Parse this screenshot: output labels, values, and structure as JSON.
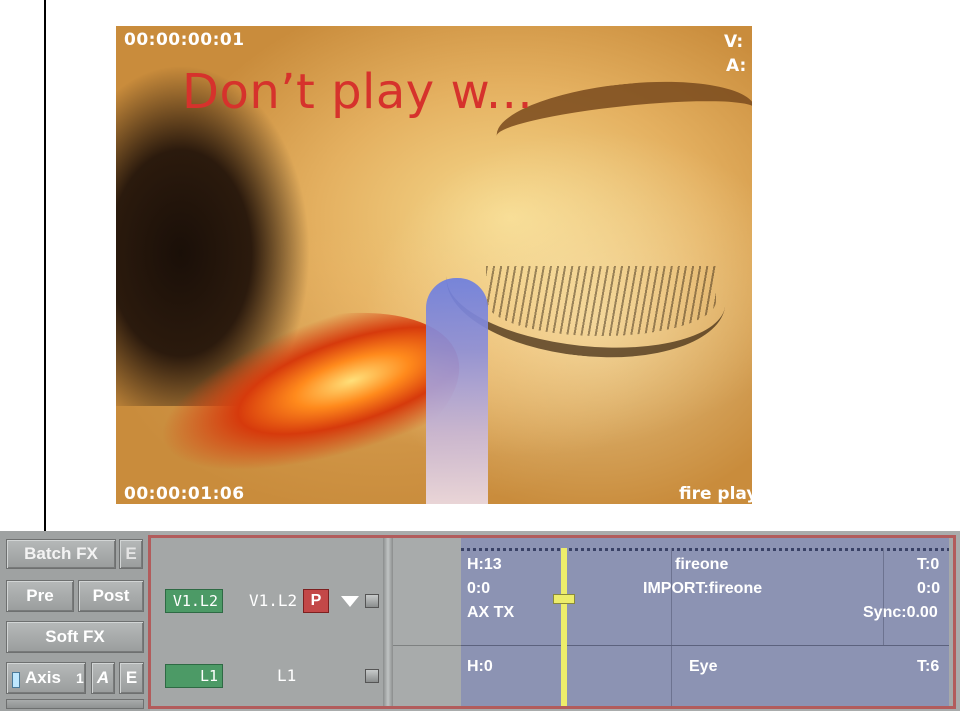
{
  "viewer": {
    "timecode_top": "00:00:00:01",
    "timecode_bottom": "00:00:01:06",
    "caption": "Don’t play w...",
    "video_label": "V:",
    "audio_label": "A:",
    "clip_name": "fire play"
  },
  "effects_panel": {
    "batch_fx": "Batch FX",
    "batch_e": "E",
    "pre": "Pre",
    "post": "Post",
    "soft_fx": "Soft FX",
    "axis": "Axis",
    "axis_number": "1",
    "a": "A",
    "e": "E"
  },
  "tracks": [
    {
      "patch": "V1.L2",
      "label": "V1.L2",
      "priority_button": "P"
    },
    {
      "patch": "L1",
      "label": "L1"
    }
  ],
  "clip_main": {
    "handles": "H:13",
    "name": "fireone",
    "tail": "T:0",
    "offset_left": "0:0",
    "source": "IMPORT:fireone",
    "offset_right": "0:0",
    "fx": "AX TX",
    "sync": "Sync:0.00"
  },
  "clip_sub": {
    "handles": "H:0",
    "name": "Eye",
    "tail": "T:6"
  },
  "colors": {
    "caption": "#d6322c",
    "track_patch": "#4c9a66",
    "priority_button": "#c34848",
    "clip": "#8c93b3",
    "positioner": "#eded6a",
    "timeline_border": "#b25c5c"
  }
}
